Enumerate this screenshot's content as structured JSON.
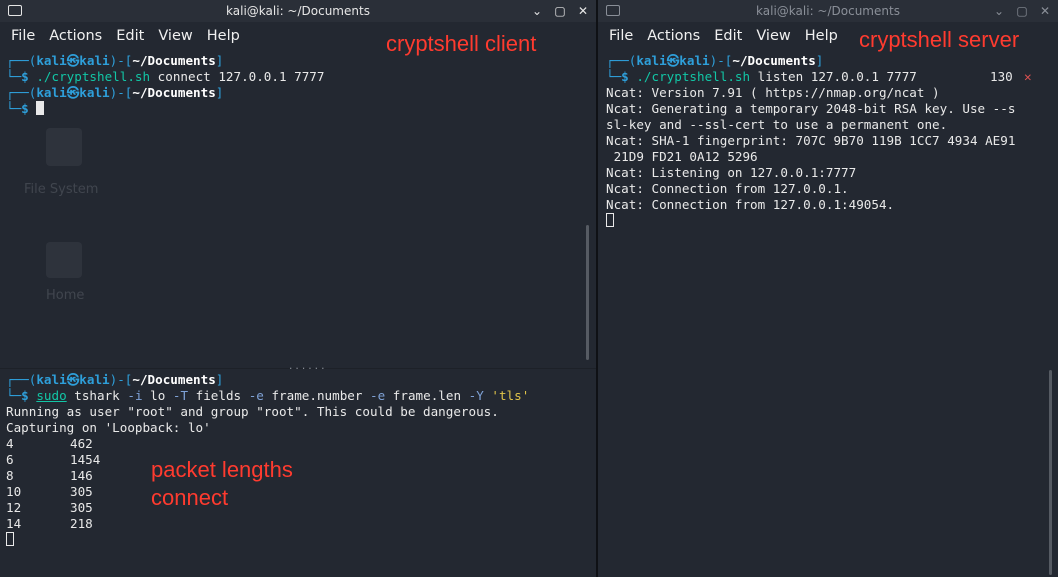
{
  "left_window": {
    "title": "kali@kali: ~/Documents",
    "controls": [
      "⌄",
      "▢",
      "✕"
    ],
    "menu": [
      "File",
      "Actions",
      "Edit",
      "View",
      "Help"
    ],
    "annotation": "cryptshell client",
    "desktop_ghosts": {
      "fs": "File System",
      "home": "Home"
    },
    "top_pane": {
      "prompt1_user": "kali",
      "prompt1_host": "kali",
      "prompt1_dir": "~/Documents",
      "cmd1": "./cryptshell.sh",
      "cmd1_args": " connect 127.0.0.1 7777",
      "prompt2_user": "kali",
      "prompt2_host": "kali",
      "prompt2_dir": "~/Documents"
    },
    "split_handle": "......",
    "bottom_pane": {
      "prompt_user": "kali",
      "prompt_host": "kali",
      "prompt_dir": "~/Documents",
      "cmd_sudo": "sudo",
      "cmd_tshark": " tshark ",
      "opt_i": "-i",
      "val_lo": " lo ",
      "opt_T": "-T",
      "val_fields": " fields ",
      "opt_e1": "-e",
      "val_fn": " frame.number ",
      "opt_e2": "-e",
      "val_fl": " frame.len ",
      "opt_Y": "-Y",
      "val_tls": " 'tls'",
      "out1": "Running as user \"root\" and group \"root\". This could be dangerous.",
      "out2": "Capturing on 'Loopback: lo'",
      "rows": [
        {
          "frame": "4",
          "len": "462"
        },
        {
          "frame": "6",
          "len": "1454"
        },
        {
          "frame": "8",
          "len": "146"
        },
        {
          "frame": "10",
          "len": "305"
        },
        {
          "frame": "12",
          "len": "305"
        },
        {
          "frame": "14",
          "len": "218"
        }
      ],
      "annotation_line1": "packet lengths",
      "annotation_line2": "connect"
    }
  },
  "right_window": {
    "title": "kali@kali: ~/Documents",
    "controls": [
      "⌄",
      "▢",
      "✕"
    ],
    "menu": [
      "File",
      "Actions",
      "Edit",
      "View",
      "Help"
    ],
    "annotation": "cryptshell server",
    "prompt_user": "kali",
    "prompt_host": "kali",
    "prompt_dir": "~/Documents",
    "cmd": "./cryptshell.sh",
    "cmd_args": " listen 127.0.0.1 7777",
    "exit_code": "130",
    "exit_mark": "✕",
    "output": [
      "Ncat: Version 7.91 ( https://nmap.org/ncat )",
      "Ncat: Generating a temporary 2048-bit RSA key. Use --s",
      "sl-key and --ssl-cert to use a permanent one.",
      "Ncat: SHA-1 fingerprint: 707C 9B70 119B 1CC7 4934 AE91",
      " 21D9 FD21 0A12 5296",
      "Ncat: Listening on 127.0.0.1:7777",
      "Ncat: Connection from 127.0.0.1.",
      "Ncat: Connection from 127.0.0.1:49054."
    ]
  },
  "colors": {
    "background": "#232831",
    "prompt": "#2e9fda",
    "command": "#12c6a6",
    "annotation": "#ff3b2f"
  }
}
